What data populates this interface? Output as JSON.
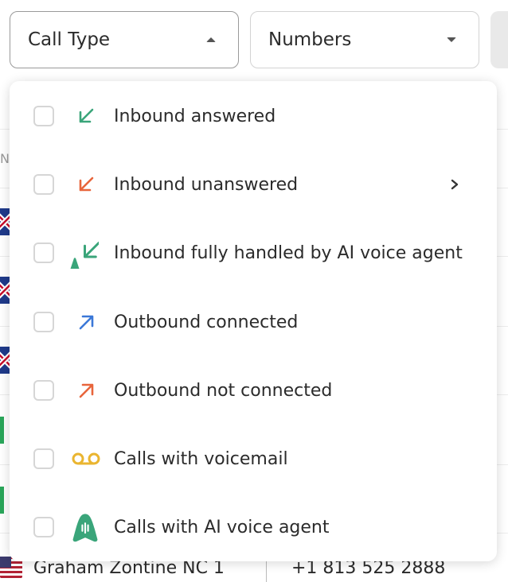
{
  "filters": {
    "call_type_label": "Call Type",
    "numbers_label": "Numbers"
  },
  "background": {
    "column_hint": "Nu",
    "bottom_row": {
      "name": "Graham Zontine NC 1",
      "number": "+1 813 525 2888"
    }
  },
  "dropdown": {
    "options": [
      {
        "label": "Inbound answered",
        "icon": "arrow-down-left-icon",
        "color": "#3aa57a"
      },
      {
        "label": "Inbound unanswered",
        "icon": "arrow-down-left-icon",
        "color": "#e8653b",
        "has_submenu": true
      },
      {
        "label": "Inbound fully handled by AI voice agent",
        "icon": "ai-inbound-icon",
        "color": "#3aa57a"
      },
      {
        "label": "Outbound connected",
        "icon": "arrow-up-right-icon",
        "color": "#3b78d8"
      },
      {
        "label": "Outbound not connected",
        "icon": "arrow-up-right-icon",
        "color": "#e8653b"
      },
      {
        "label": "Calls with voicemail",
        "icon": "voicemail-icon",
        "color": "#eab530"
      },
      {
        "label": "Calls with AI voice agent",
        "icon": "ai-agent-icon",
        "color": "#3aa57a"
      }
    ]
  }
}
